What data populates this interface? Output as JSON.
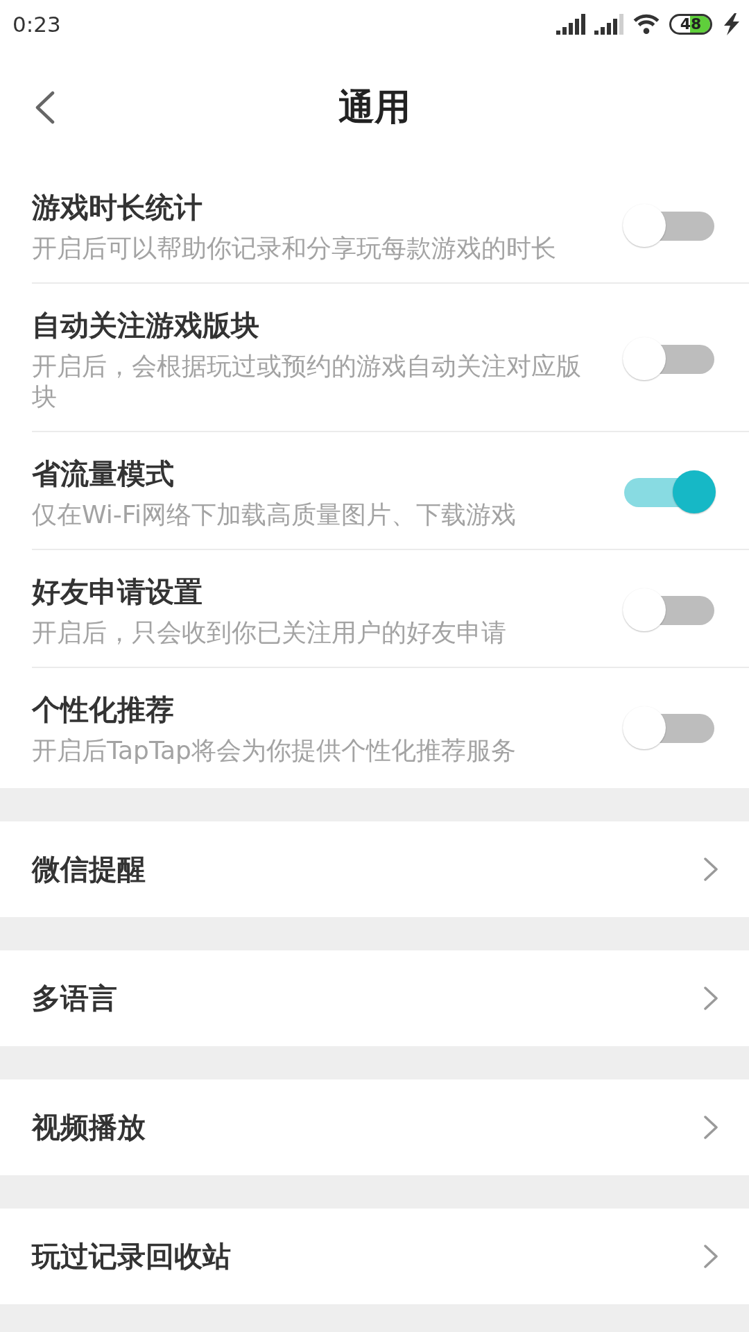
{
  "status_bar": {
    "time": "0:23",
    "battery": "48"
  },
  "header": {
    "title": "通用"
  },
  "toggle_settings": [
    {
      "title": "游戏时长统计",
      "description": "开启后可以帮助你记录和分享玩每款游戏的时长",
      "on": false
    },
    {
      "title": "自动关注游戏版块",
      "description": "开启后，会根据玩过或预约的游戏自动关注对应版块",
      "on": false
    },
    {
      "title": "省流量模式",
      "description": "仅在Wi-Fi网络下加载高质量图片、下载游戏",
      "on": true
    },
    {
      "title": "好友申请设置",
      "description": "开启后，只会收到你已关注用户的好友申请",
      "on": false
    },
    {
      "title": "个性化推荐",
      "description": "开启后TapTap将会为你提供个性化推荐服务",
      "on": false
    }
  ],
  "menu_items": [
    {
      "label": "微信提醒"
    },
    {
      "label": "多语言"
    },
    {
      "label": "视频播放"
    },
    {
      "label": "玩过记录回收站"
    }
  ]
}
